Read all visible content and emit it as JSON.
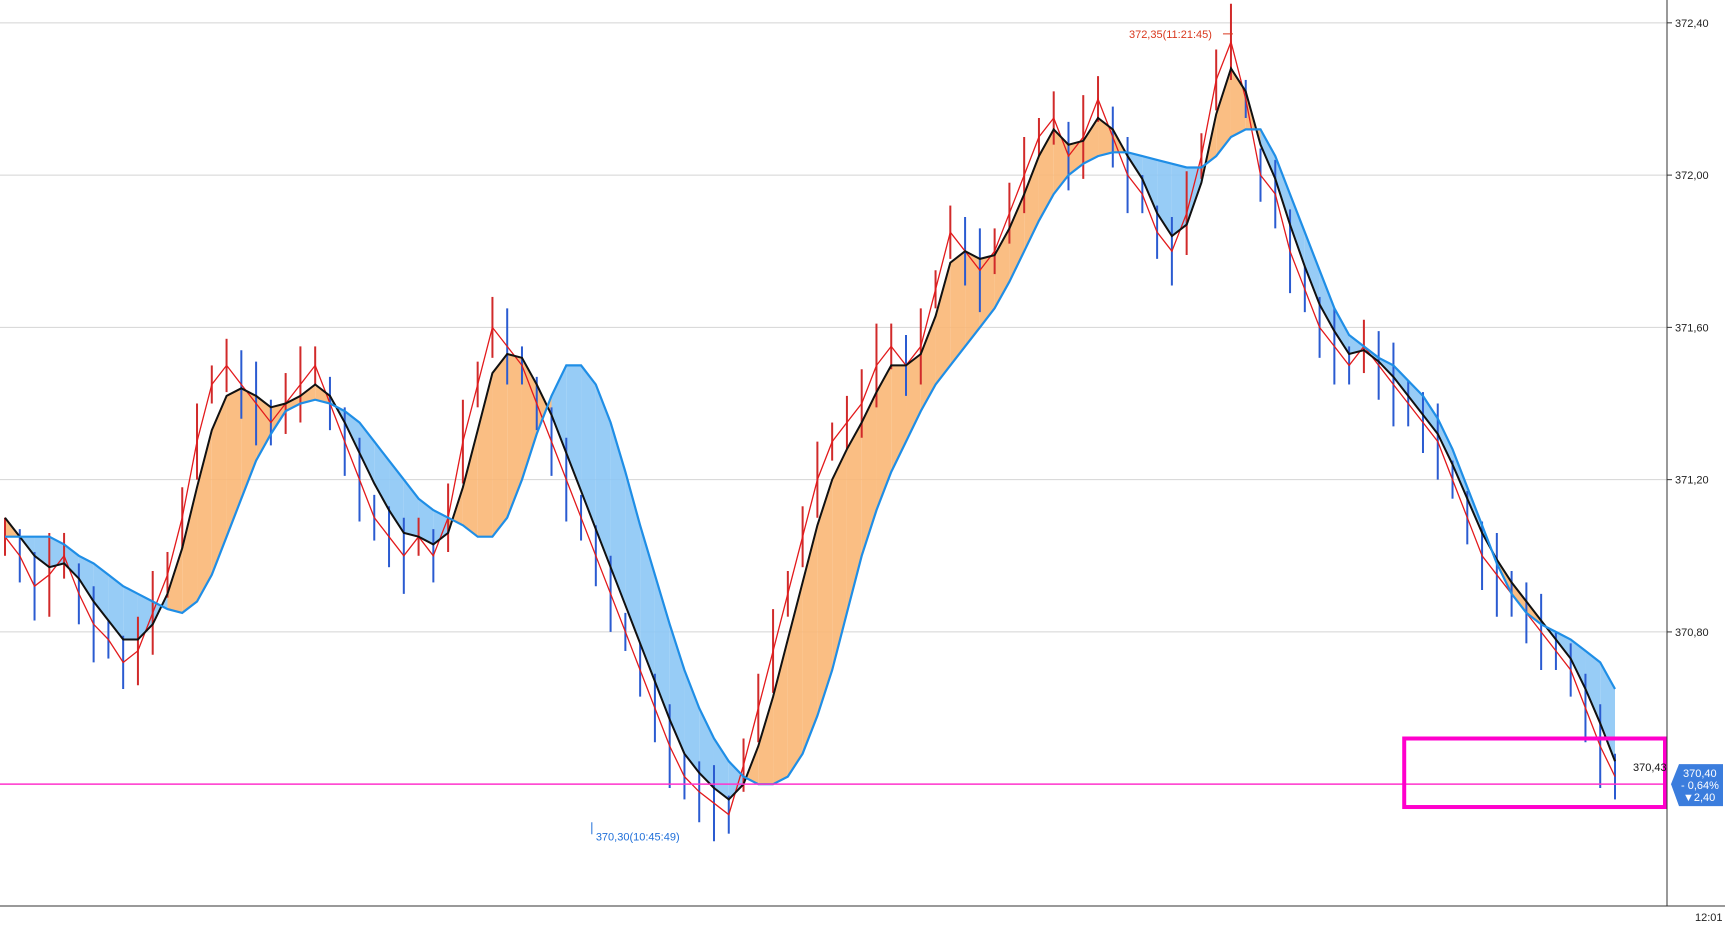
{
  "chart_data": {
    "type": "line",
    "title": "",
    "xlabel": "",
    "ylabel": "",
    "ylim": [
      370.08,
      372.46
    ],
    "y_ticks": [
      370.8,
      371.2,
      371.6,
      372.0,
      372.4
    ],
    "y_tick_labels": [
      "370,80",
      "371,20",
      "371,60",
      "372,00",
      "372,40"
    ],
    "x_tick_labels": [
      "12:01"
    ],
    "grid": true,
    "series": [
      {
        "name": "",
        "color": "#e31a1c",
        "values": [
          371.05,
          371.0,
          370.92,
          370.95,
          371.0,
          370.9,
          370.82,
          370.78,
          370.72,
          370.75,
          370.85,
          370.95,
          371.1,
          371.3,
          371.45,
          371.5,
          371.45,
          371.4,
          371.35,
          371.4,
          371.45,
          371.5,
          371.4,
          371.3,
          371.2,
          371.1,
          371.05,
          371.0,
          371.05,
          371.0,
          371.1,
          371.3,
          371.45,
          371.6,
          371.55,
          371.5,
          371.4,
          371.3,
          371.2,
          371.1,
          371.0,
          370.9,
          370.8,
          370.7,
          370.6,
          370.5,
          370.42,
          370.38,
          370.35,
          370.32,
          370.45,
          370.6,
          370.75,
          370.9,
          371.05,
          371.2,
          371.3,
          371.35,
          371.4,
          371.5,
          371.55,
          371.5,
          371.55,
          371.7,
          371.85,
          371.8,
          371.75,
          371.8,
          371.9,
          372.0,
          372.1,
          372.15,
          372.05,
          372.1,
          372.2,
          372.1,
          372.0,
          371.95,
          371.85,
          371.8,
          371.9,
          372.05,
          372.25,
          372.35,
          372.2,
          372.0,
          371.95,
          371.8,
          371.7,
          371.6,
          371.55,
          371.5,
          371.55,
          371.5,
          371.45,
          371.4,
          371.35,
          371.3,
          371.2,
          371.1,
          371.0,
          370.95,
          370.9,
          370.85,
          370.8,
          370.75,
          370.7,
          370.6,
          370.5,
          370.42
        ]
      },
      {
        "name": "",
        "color": "#111111",
        "values": [
          371.1,
          371.05,
          371.0,
          370.97,
          370.98,
          370.94,
          370.88,
          370.83,
          370.78,
          370.78,
          370.82,
          370.9,
          371.02,
          371.18,
          371.33,
          371.42,
          371.44,
          371.42,
          371.39,
          371.4,
          371.42,
          371.45,
          371.42,
          371.35,
          371.27,
          371.19,
          371.12,
          371.06,
          371.05,
          371.03,
          371.06,
          371.18,
          371.33,
          371.48,
          371.53,
          371.52,
          371.45,
          371.37,
          371.27,
          371.17,
          371.07,
          370.97,
          370.87,
          370.77,
          370.67,
          370.57,
          370.48,
          370.43,
          370.39,
          370.36,
          370.4,
          370.5,
          370.63,
          370.78,
          370.93,
          371.08,
          371.2,
          371.28,
          371.35,
          371.43,
          371.5,
          371.5,
          371.53,
          371.63,
          371.77,
          371.8,
          371.78,
          371.79,
          371.86,
          371.95,
          372.05,
          372.12,
          372.08,
          372.09,
          372.15,
          372.12,
          372.05,
          371.99,
          371.9,
          371.84,
          371.87,
          371.98,
          372.16,
          372.28,
          372.22,
          372.08,
          371.99,
          371.87,
          371.76,
          371.66,
          371.59,
          371.53,
          371.54,
          371.51,
          371.47,
          371.42,
          371.37,
          371.32,
          371.24,
          371.15,
          371.06,
          370.99,
          370.93,
          370.88,
          370.83,
          370.78,
          370.73,
          370.65,
          370.56,
          370.46
        ]
      },
      {
        "name": "",
        "color": "#1f8ee6",
        "values": [
          371.05,
          371.05,
          371.05,
          371.05,
          371.03,
          371.0,
          370.98,
          370.95,
          370.92,
          370.9,
          370.88,
          370.86,
          370.85,
          370.88,
          370.95,
          371.05,
          371.15,
          371.25,
          371.32,
          371.38,
          371.4,
          371.41,
          371.4,
          371.38,
          371.35,
          371.3,
          371.25,
          371.2,
          371.15,
          371.12,
          371.1,
          371.08,
          371.05,
          371.05,
          371.1,
          371.2,
          371.32,
          371.42,
          371.5,
          371.5,
          371.45,
          371.35,
          371.22,
          371.08,
          370.95,
          370.82,
          370.7,
          370.6,
          370.52,
          370.46,
          370.42,
          370.4,
          370.4,
          370.42,
          370.48,
          370.58,
          370.7,
          370.85,
          371.0,
          371.12,
          371.22,
          371.3,
          371.38,
          371.45,
          371.5,
          371.55,
          371.6,
          371.65,
          371.72,
          371.8,
          371.88,
          371.95,
          372.0,
          372.03,
          372.05,
          372.06,
          372.06,
          372.05,
          372.04,
          372.03,
          372.02,
          372.02,
          372.05,
          372.1,
          372.12,
          372.12,
          372.05,
          371.95,
          371.85,
          371.75,
          371.65,
          371.58,
          371.55,
          371.52,
          371.5,
          371.46,
          371.42,
          371.36,
          371.28,
          371.18,
          371.08,
          370.98,
          370.9,
          370.85,
          370.82,
          370.8,
          370.78,
          370.75,
          370.72,
          370.65
        ]
      }
    ],
    "annotations": [
      {
        "text": "372,35(11:21:45)",
        "x_index": 83,
        "y": 372.35,
        "color": "#d9381e"
      },
      {
        "text": "370,30(10:45:49)",
        "x_index": 40,
        "y": 370.3,
        "color": "#1f6fd9"
      },
      {
        "text": "370,43",
        "x_index": 109,
        "y": 370.43,
        "color": "#111111"
      }
    ],
    "current_price_badge": {
      "price": "370,40",
      "change_pct": "- 0,64%",
      "change": "▼2,40",
      "color": "#3b7ddd"
    },
    "reference_line": {
      "y": 370.4,
      "color": "#ff33cc"
    },
    "highlight_box": {
      "y_top": 370.52,
      "y_bottom": 370.34,
      "x_start_index": 95,
      "color": "#ff00cc"
    }
  }
}
